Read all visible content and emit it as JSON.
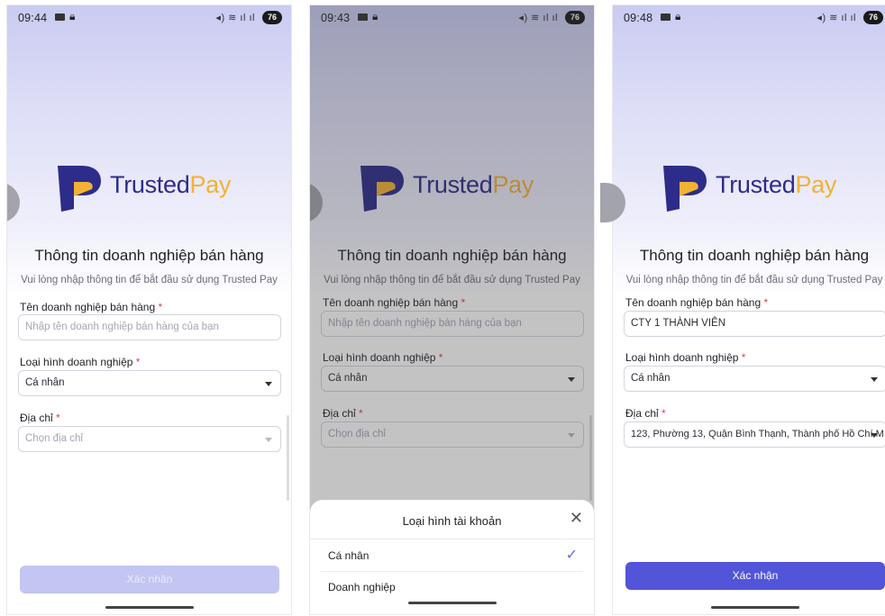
{
  "brand": {
    "word_a": "Trusted",
    "word_b": "Pay"
  },
  "form": {
    "title": "Thông tin doanh nghiệp bán hàng",
    "subtitle": "Vui lòng nhập thông tin để bắt đầu sử dụng Trusted Pay",
    "name_label": "Tên doanh nghiệp bán hàng",
    "type_label": "Loại hình doanh nghiệp",
    "address_label": "Địa chỉ",
    "required_mark": "*",
    "submit_label": "Xác nhận"
  },
  "screens": [
    {
      "status": {
        "time": "09:44",
        "battery": "76"
      },
      "name_placeholder": "Nhập tên doanh nghiệp bán hàng của bạn",
      "name_value": "",
      "type_value": "Cá nhân",
      "address_placeholder": "Chọn địa chỉ",
      "address_value": "",
      "submit_enabled": false
    },
    {
      "status": {
        "time": "09:43",
        "battery": "76"
      },
      "name_placeholder": "Nhập tên doanh nghiệp bán hàng của bạn",
      "name_value": "",
      "type_value": "Cá nhân",
      "address_placeholder": "Chọn địa chỉ",
      "address_value": "",
      "sheet": {
        "title": "Loại hình tài khoản",
        "options": [
          "Cá nhân",
          "Doanh nghiệp"
        ],
        "selected": "Cá nhân"
      }
    },
    {
      "status": {
        "time": "09:48",
        "battery": "76"
      },
      "name_value": "CTY 1 THÀNH VIÊN",
      "type_value": "Cá nhân",
      "address_value": "123, Phường 13, Quận Bình Thạnh, Thành phố Hồ Chí M",
      "submit_enabled": true
    }
  ],
  "colors": {
    "primary": "#5255d9",
    "primary_disabled": "#c3c5f2",
    "brand_navy": "#2d2c8a",
    "brand_orange": "#f2b233",
    "required": "#e0434b"
  },
  "icons": {
    "status_notify": "mail-icon",
    "status_lock": "lock-icon",
    "status_signal": "signal-icon",
    "close": "close-icon",
    "check": "check-icon",
    "dropdown": "caret-down-icon"
  }
}
